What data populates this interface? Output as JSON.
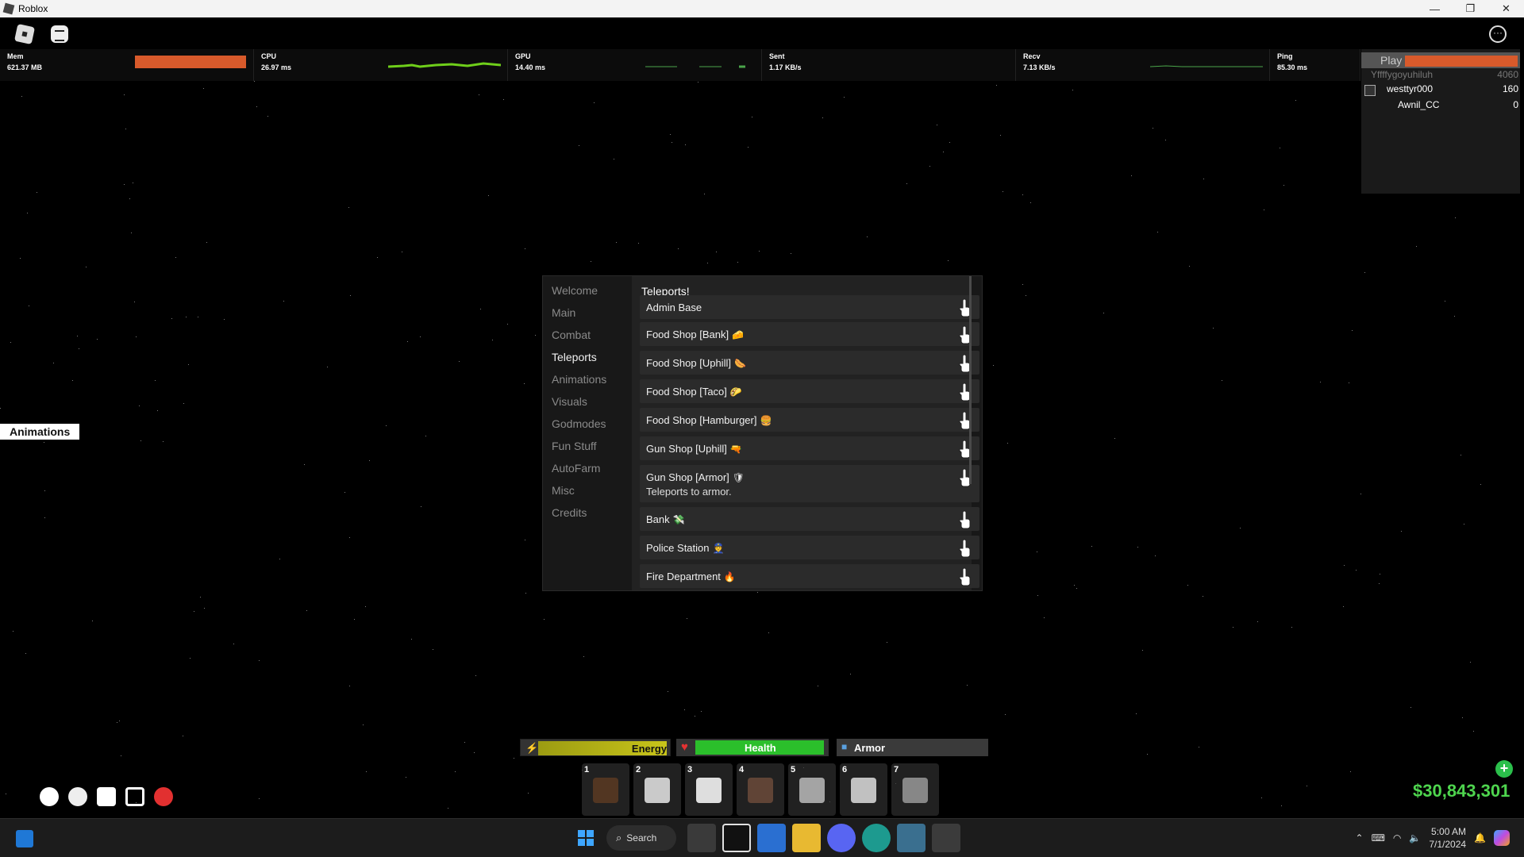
{
  "window": {
    "title": "Roblox"
  },
  "stats": [
    {
      "label": "Mem",
      "value": "621.37 MB"
    },
    {
      "label": "CPU",
      "value": "26.97 ms"
    },
    {
      "label": "GPU",
      "value": "14.40 ms"
    },
    {
      "label": "Sent",
      "value": "1.17 KB/s"
    },
    {
      "label": "Recv",
      "value": "7.13 KB/s"
    },
    {
      "label": "Ping",
      "value": "85.30 ms"
    }
  ],
  "playerlist": {
    "header": "Play",
    "players": [
      {
        "name": "Yffffygoyuhiluh",
        "score": "4060"
      },
      {
        "name": "westtyr000",
        "score": "160"
      },
      {
        "name": "Awnil_CC",
        "score": "0"
      }
    ]
  },
  "side_tag": "Animations",
  "hub": {
    "nav": [
      "Welcome",
      "Main",
      "Combat",
      "Teleports",
      "Animations",
      "Visuals",
      "Godmodes",
      "Fun Stuff",
      "AutoFarm",
      "Misc",
      "Credits"
    ],
    "active_nav": "Teleports",
    "title": "Teleports!",
    "teleports": [
      {
        "name": "Admin Base",
        "emoji": ""
      },
      {
        "name": "Food Shop [Bank]",
        "emoji": "🧀"
      },
      {
        "name": "Food Shop [Uphill]",
        "emoji": "🌭"
      },
      {
        "name": "Food Shop [Taco]",
        "emoji": "🌮"
      },
      {
        "name": "Food Shop [Hamburger]",
        "emoji": "🍔"
      },
      {
        "name": "Gun Shop [Uphill]",
        "emoji": "🔫"
      },
      {
        "name": "Gun Shop [Armor]",
        "emoji": "🛡",
        "description": "Teleports to armor."
      },
      {
        "name": "Bank",
        "emoji": "💸"
      },
      {
        "name": "Police Station",
        "emoji": "👮"
      },
      {
        "name": "Fire Department",
        "emoji": "🔥"
      }
    ]
  },
  "status_bars": {
    "energy": "Energy",
    "health": "Health",
    "armor": "Armor"
  },
  "hotbar": [
    {
      "slot": "1",
      "tool": "bat-icon"
    },
    {
      "slot": "2",
      "tool": "wallet-icon"
    },
    {
      "slot": "3",
      "tool": "phone-icon"
    },
    {
      "slot": "4",
      "tool": "boombox-icon"
    },
    {
      "slot": "5",
      "tool": "knife-icon"
    },
    {
      "slot": "6",
      "tool": "katana-icon"
    },
    {
      "slot": "7",
      "tool": "spray-can-icon"
    }
  ],
  "money": "$30,843,301",
  "taskbar": {
    "search_label": "Search",
    "time": "5:00 AM",
    "date": "7/1/2024"
  },
  "colors": {
    "accent_orange": "#d85a2b",
    "health_green": "#2bbf2b",
    "energy_yellow": "#c8c41a",
    "money_green": "#4ed54e"
  }
}
